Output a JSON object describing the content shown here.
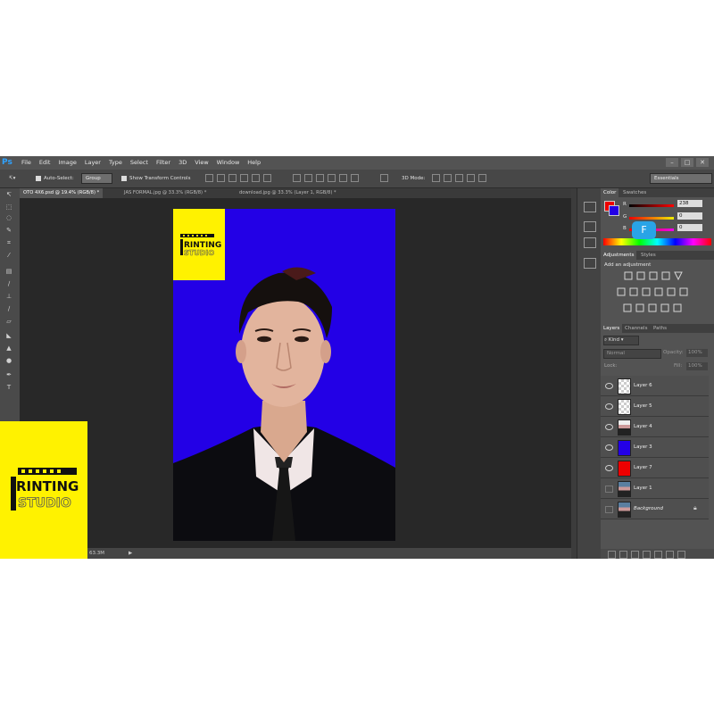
{
  "app": {
    "logo": "Ps",
    "menu": [
      "File",
      "Edit",
      "Image",
      "Layer",
      "Type",
      "Select",
      "Filter",
      "3D",
      "View",
      "Window",
      "Help"
    ],
    "window_controls": [
      "–",
      "□",
      "✕"
    ]
  },
  "options_bar": {
    "auto_select_label": "Auto-Select:",
    "auto_select_value": "Group",
    "show_transform_label": "Show Transform Controls",
    "mode_3d_label": "3D Mode:",
    "workspace_value": "Essentials"
  },
  "tabs": [
    {
      "label": "OTO 4X6.psd @ 19.4% (RGB/8) *",
      "active": true
    },
    {
      "label": "JAS FORMAL.jpg @ 33.3% (RGB/8) *",
      "active": false
    },
    {
      "label": "download.jpg @ 33.3% (Layer 1, RGB/8) *",
      "active": false
    }
  ],
  "status": {
    "doc_size": "63.3M"
  },
  "color_panel": {
    "tabs": [
      "Color",
      "Swatches"
    ],
    "channels": [
      {
        "label": "R",
        "value": "238"
      },
      {
        "label": "G",
        "value": "0"
      },
      {
        "label": "B",
        "value": "0"
      }
    ],
    "foreground": "#ee0000",
    "background": "#2300e6"
  },
  "adjustments_panel": {
    "tabs": [
      "Adjustments",
      "Styles"
    ],
    "heading": "Add an adjustment"
  },
  "layers_panel": {
    "tabs": [
      "Layers",
      "Channels",
      "Paths"
    ],
    "kind_label": "Kind",
    "blend_mode": "Normal",
    "opacity_label": "Opacity:",
    "opacity_value": "100%",
    "lock_label": "Lock:",
    "fill_label": "Fill:",
    "fill_value": "100%",
    "layers": [
      {
        "name": "Layer 6",
        "thumb": "checker",
        "visible": true
      },
      {
        "name": "Layer 5",
        "thumb": "checker-figure",
        "visible": true
      },
      {
        "name": "Layer 4",
        "thumb": "portrait",
        "visible": true
      },
      {
        "name": "Layer 3",
        "thumb": "#2300e6",
        "visible": true
      },
      {
        "name": "Layer 7",
        "thumb": "#ee0000",
        "visible": true
      },
      {
        "name": "Layer 1",
        "thumb": "portrait",
        "visible": false
      },
      {
        "name": "Background",
        "thumb": "portrait",
        "visible": false,
        "italic": true,
        "locked": true
      }
    ]
  },
  "logo_text": {
    "line1": "RINTING",
    "line2": "STUDIO"
  },
  "badge": {
    "letter": "F"
  },
  "colors": {
    "canvas_bg": "#2300e6",
    "logo_yellow": "#fff200",
    "accent_blue": "#29a4e6"
  }
}
